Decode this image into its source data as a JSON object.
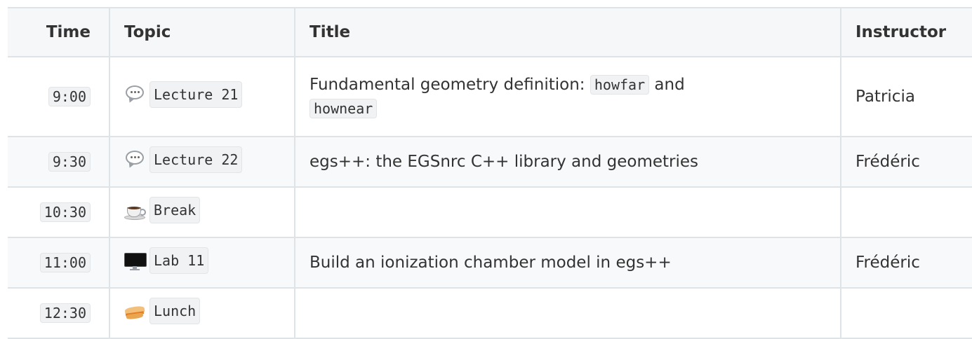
{
  "table": {
    "headers": {
      "time": "Time",
      "topic": "Topic",
      "title": "Title",
      "instructor": "Instructor"
    },
    "rows": [
      {
        "time": "9:00",
        "topic_icon": "speech-bubble-icon",
        "topic": "Lecture 21",
        "title_text": "Fundamental geometry definition: ",
        "title_code1": "howfar",
        "title_mid": " and ",
        "title_code2": "hownear",
        "instructor": "Patricia"
      },
      {
        "time": "9:30",
        "topic_icon": "speech-bubble-icon",
        "topic": "Lecture 22",
        "title_text": "egs++: the EGSnrc C++ library and geometries",
        "instructor": "Frédéric"
      },
      {
        "time": "10:30",
        "topic_icon": "coffee-icon",
        "topic": "Break",
        "title_text": "",
        "instructor": ""
      },
      {
        "time": "11:00",
        "topic_icon": "computer-monitor-icon",
        "topic": "Lab 11",
        "title_text": "Build an ionization chamber model in egs++",
        "instructor": "Frédéric"
      },
      {
        "time": "12:30",
        "topic_icon": "sandwich-icon",
        "topic": "Lunch",
        "title_text": "",
        "instructor": ""
      }
    ]
  },
  "colors": {
    "border": "#dde3e7",
    "header_bg": "#f6f7f9",
    "stripe_bg": "#f8f9fa",
    "code_bg": "#f1f2f4",
    "text": "#333333"
  }
}
